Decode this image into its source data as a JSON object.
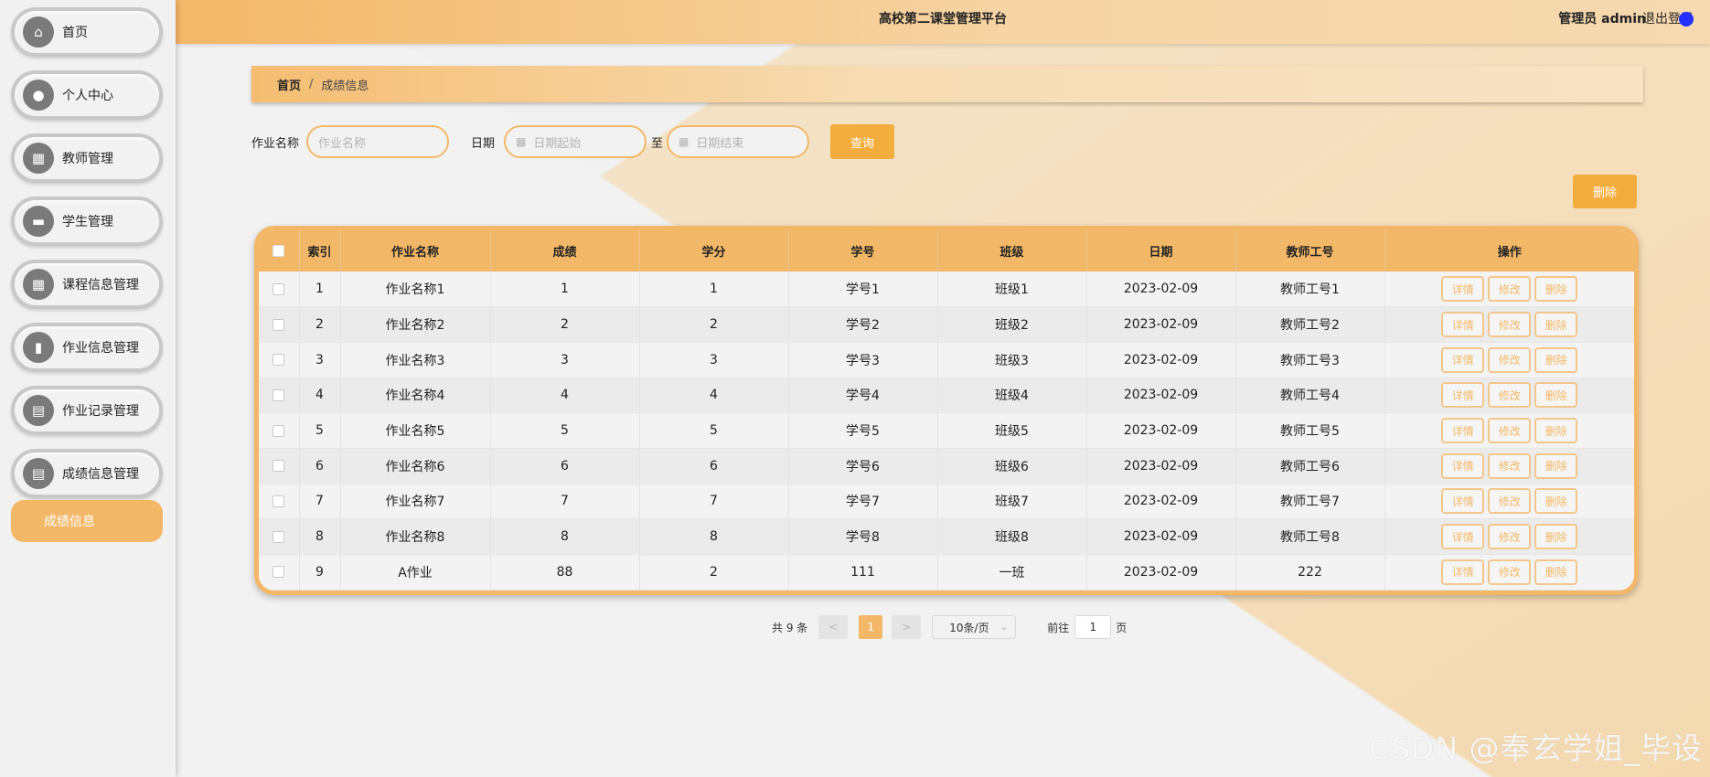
{
  "app": {
    "title": "高校第二课堂管理平台",
    "user": "管理员 admin",
    "logout": "退出登录"
  },
  "sidebar": {
    "items": [
      {
        "label": "首页",
        "icon": "home-icon",
        "glyph": "⌂"
      },
      {
        "label": "个人中心",
        "icon": "user-icon",
        "glyph": "●"
      },
      {
        "label": "教师管理",
        "icon": "grid-icon",
        "glyph": "▦"
      },
      {
        "label": "学生管理",
        "icon": "briefcase-icon",
        "glyph": "▬"
      },
      {
        "label": "课程信息管理",
        "icon": "grid-icon",
        "glyph": "▦"
      },
      {
        "label": "作业信息管理",
        "icon": "book-icon",
        "glyph": "▮"
      },
      {
        "label": "作业记录管理",
        "icon": "clipboard-icon",
        "glyph": "▤"
      },
      {
        "label": "成绩信息管理",
        "icon": "clipboard-icon",
        "glyph": "▤"
      }
    ],
    "submenu": "成绩信息"
  },
  "breadcrumb": {
    "home": "首页",
    "sep": "/",
    "current": "成绩信息"
  },
  "search": {
    "name_label": "作业名称",
    "name_placeholder": "作业名称",
    "date_label": "日期",
    "date_start_placeholder": "日期起始",
    "to_label": "至",
    "date_end_placeholder": "日期结束",
    "query_button": "查询"
  },
  "delete_button": "删除",
  "table": {
    "headers": [
      "索引",
      "作业名称",
      "成绩",
      "学分",
      "学号",
      "班级",
      "日期",
      "教师工号",
      "操作"
    ],
    "ops": {
      "detail": "详情",
      "edit": "修改",
      "delete": "删除"
    },
    "rows": [
      [
        "1",
        "作业名称1",
        "1",
        "1",
        "学号1",
        "班级1",
        "2023-02-09",
        "教师工号1"
      ],
      [
        "2",
        "作业名称2",
        "2",
        "2",
        "学号2",
        "班级2",
        "2023-02-09",
        "教师工号2"
      ],
      [
        "3",
        "作业名称3",
        "3",
        "3",
        "学号3",
        "班级3",
        "2023-02-09",
        "教师工号3"
      ],
      [
        "4",
        "作业名称4",
        "4",
        "4",
        "学号4",
        "班级4",
        "2023-02-09",
        "教师工号4"
      ],
      [
        "5",
        "作业名称5",
        "5",
        "5",
        "学号5",
        "班级5",
        "2023-02-09",
        "教师工号5"
      ],
      [
        "6",
        "作业名称6",
        "6",
        "6",
        "学号6",
        "班级6",
        "2023-02-09",
        "教师工号6"
      ],
      [
        "7",
        "作业名称7",
        "7",
        "7",
        "学号7",
        "班级7",
        "2023-02-09",
        "教师工号7"
      ],
      [
        "8",
        "作业名称8",
        "8",
        "8",
        "学号8",
        "班级8",
        "2023-02-09",
        "教师工号8"
      ],
      [
        "9",
        "A作业",
        "88",
        "2",
        "111",
        "一班",
        "2023-02-09",
        "222"
      ]
    ]
  },
  "pagination": {
    "total": "共 9 条",
    "prev": "<",
    "page": "1",
    "next": ">",
    "page_size": "10条/页",
    "goto_label": "前往",
    "goto_value": "1",
    "page_unit": "页"
  },
  "watermark": "CSDN @奉玄学姐_毕设",
  "colors": {
    "accent": "#f3b867",
    "button": "#f3ad3e",
    "sidebar_icon": "#7a7a7a"
  }
}
